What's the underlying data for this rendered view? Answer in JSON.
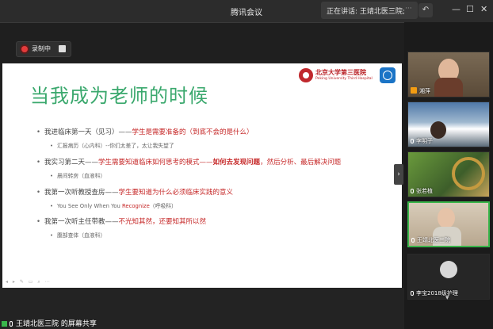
{
  "window": {
    "title": "腾讯会议",
    "speaking_text": "正在讲话: 王靖北医三院;",
    "more_glyph": "···"
  },
  "recording": {
    "label": "录制中"
  },
  "slide": {
    "title": "当我成为老师的时候",
    "logo": {
      "cn": "北京大学第三医院",
      "en": "Peking University Third Hospital"
    },
    "bullets": [
      {
        "main": {
          "a": "我进临床第一天（见习）——",
          "b": "学生是需要准备的（到底不会的是什么）",
          "c": ""
        },
        "sub": {
          "a": "汇报病历（心内科）--你们太差了，太让我失望了",
          "b": ""
        }
      },
      {
        "main": {
          "a": "我实习第二天——",
          "b": "学生需要知道临床如何思考的模式——",
          "b2": "如何去发现问题",
          "c": "，然后分析、最后解决问题"
        },
        "sub": {
          "a": "晨间转房（血液科）",
          "b": ""
        }
      },
      {
        "main": {
          "a": "我第一次听教授查房——",
          "b": "学生要知道为什么必须临床实践的意义",
          "c": ""
        },
        "sub": {
          "a": "You See Only When You ",
          "b": "Recognize",
          "c": "（呼吸科）"
        }
      },
      {
        "main": {
          "a": "我第一次听主任带教——",
          "b": "不光知其然，还要知其所以然",
          "c": ""
        },
        "sub": {
          "a": "腹部查体（血液科）",
          "b": ""
        }
      }
    ]
  },
  "participants": [
    {
      "name": "湘萍",
      "host": true,
      "active": false,
      "bg": "#8a7a60"
    },
    {
      "name": "李明子",
      "host": false,
      "active": false,
      "bg": "#6d8fb3"
    },
    {
      "name": "张若植",
      "host": false,
      "active": false,
      "bg": "#4f7a3a"
    },
    {
      "name": "王靖北医三院",
      "host": false,
      "active": true,
      "bg": "#c9b9a2"
    },
    {
      "name": "李宝2018级护理",
      "host": false,
      "active": false,
      "bg": "#2a2a2a"
    }
  ],
  "bottom": {
    "share_label": "王靖北医三院 的屏幕共享"
  }
}
